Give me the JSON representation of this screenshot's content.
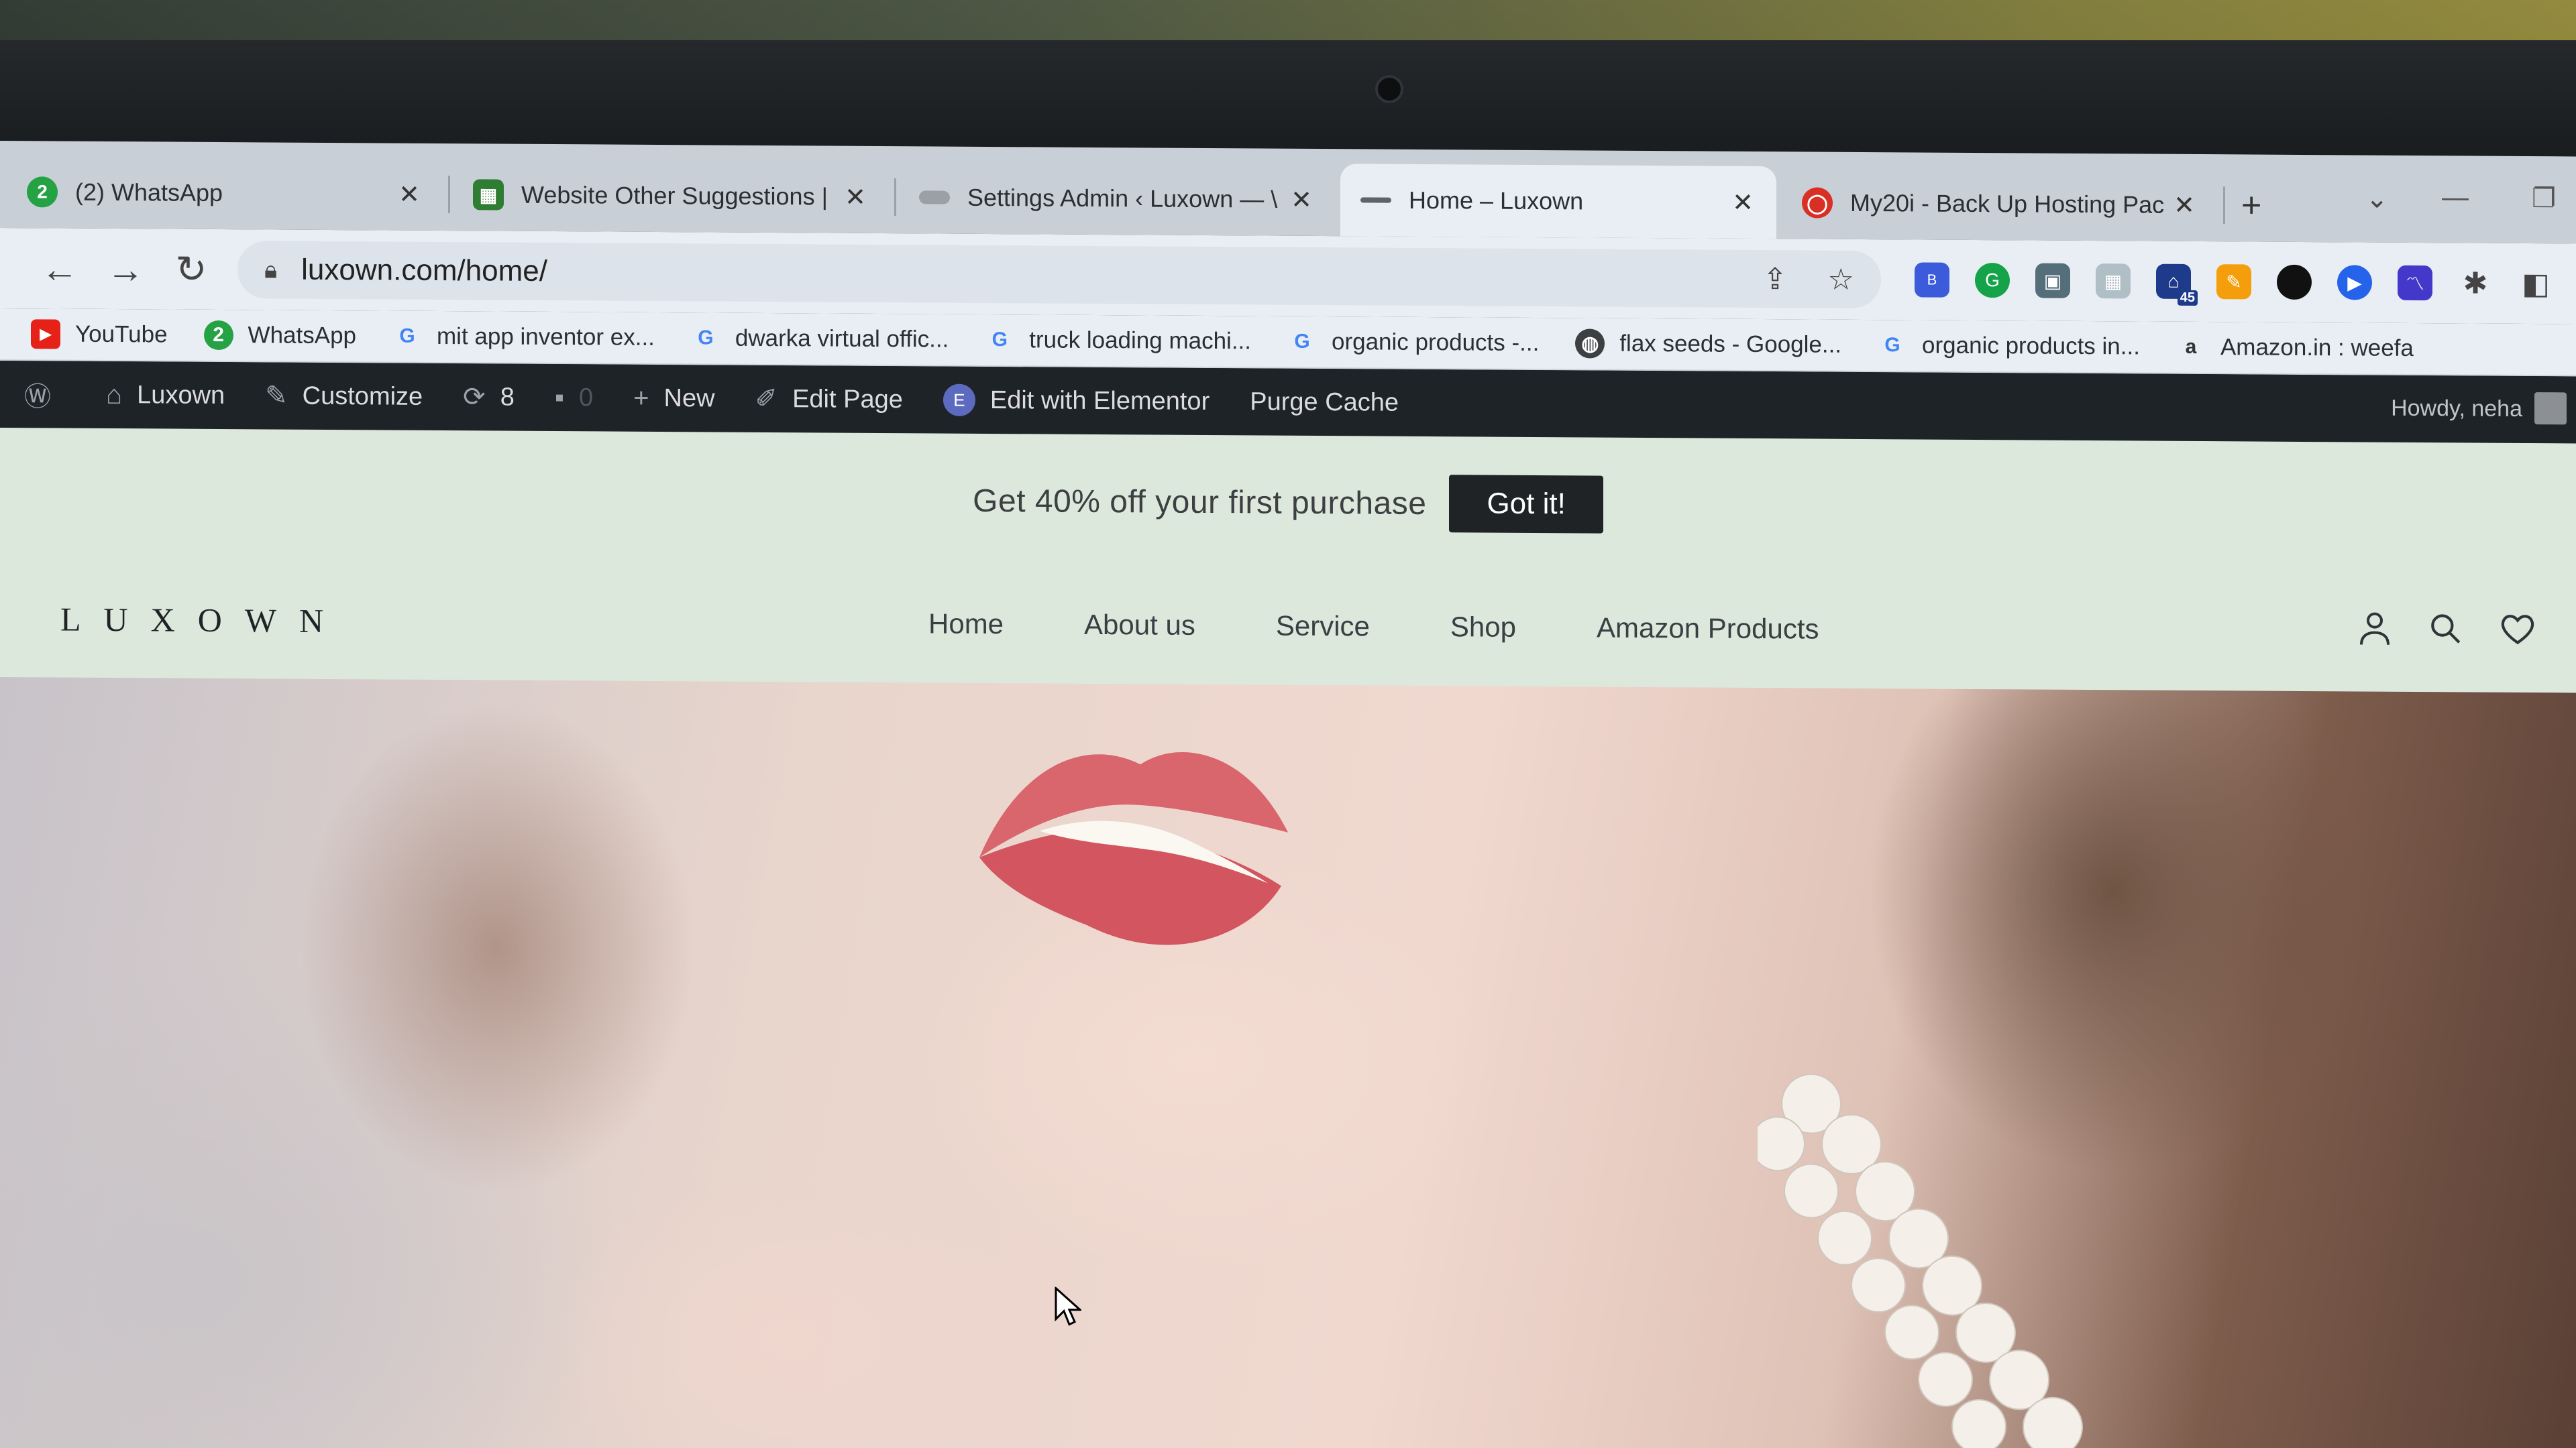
{
  "browser": {
    "tabs": [
      {
        "title": "(2) WhatsApp",
        "icon": "whatsapp-icon",
        "active": false
      },
      {
        "title": "Website Other Suggestions |",
        "icon": "sheets-icon",
        "active": false
      },
      {
        "title": "Settings Admin ‹ Luxown — \\",
        "icon": "page-icon",
        "active": false
      },
      {
        "title": "Home – Luxown",
        "icon": "page-icon",
        "active": true
      },
      {
        "title": "My20i - Back Up Hosting Pac",
        "icon": "host-icon",
        "active": false
      }
    ],
    "url": "luxown.com/home/",
    "extension_badge": "45",
    "bookmarks": [
      {
        "label": "YouTube",
        "icon": "youtube-icon"
      },
      {
        "label": "WhatsApp",
        "icon": "whatsapp-icon"
      },
      {
        "label": "mit app inventor ex...",
        "icon": "google-icon"
      },
      {
        "label": "dwarka virtual offic...",
        "icon": "google-icon"
      },
      {
        "label": "truck loading machi...",
        "icon": "google-icon"
      },
      {
        "label": "organic products -...",
        "icon": "google-icon"
      },
      {
        "label": "flax seeds - Google...",
        "icon": "globe-icon"
      },
      {
        "label": "organic products in...",
        "icon": "google-icon"
      },
      {
        "label": "Amazon.in : weefa",
        "icon": "amazon-icon"
      }
    ]
  },
  "wpbar": {
    "site": "Luxown",
    "customize": "Customize",
    "updates": "8",
    "comments": "0",
    "new": "New",
    "edit_page": "Edit Page",
    "elementor": "Edit with Elementor",
    "purge": "Purge Cache",
    "howdy": "Howdy, neha"
  },
  "promo": {
    "text": "Get 40% off your first purchase",
    "button": "Got it!"
  },
  "site": {
    "logo": "LUXOWN",
    "menu": [
      "Home",
      "About us",
      "Service",
      "Shop",
      "Amazon Products"
    ]
  },
  "colors": {
    "tab_strip": "#c9cfd6",
    "toolbar": "#e9eef4",
    "wp_bar": "#1d2327",
    "page_bg": "#dde8dc",
    "promo_button": "#1f2326",
    "lips": "#d9656d"
  }
}
